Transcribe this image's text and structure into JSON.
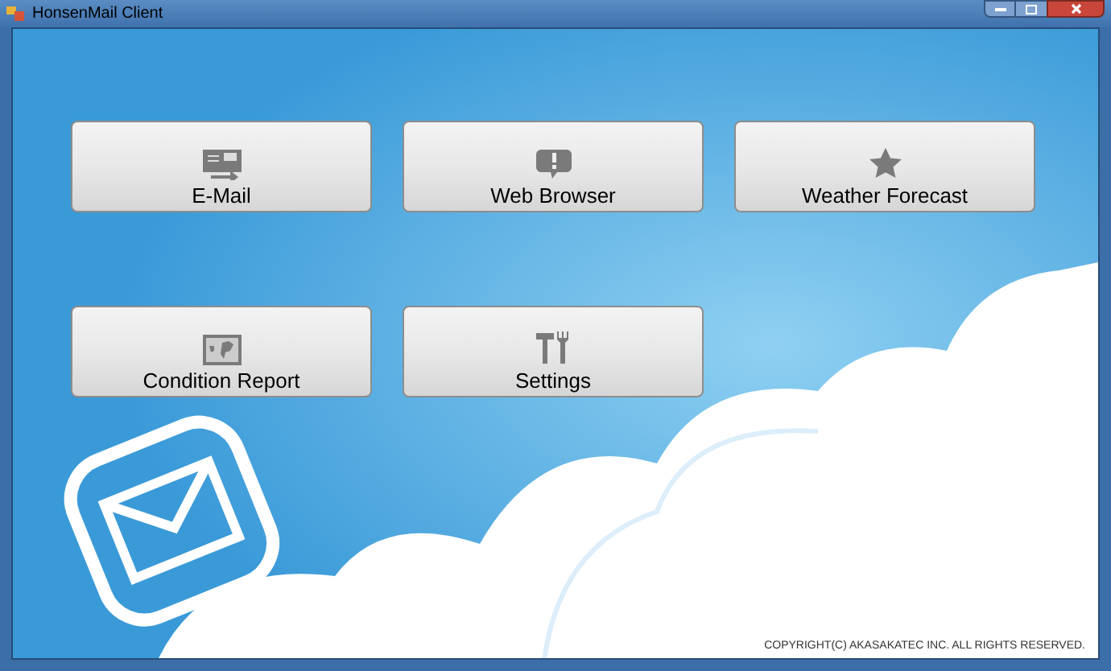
{
  "window": {
    "title": "HonsenMail Client"
  },
  "buttons": [
    {
      "label": "E-Mail",
      "kind": "mail"
    },
    {
      "label": "Web Browser",
      "kind": "chat"
    },
    {
      "label": "Weather Forecast",
      "kind": "star"
    },
    {
      "label": "Condition Report",
      "kind": "map"
    },
    {
      "label": "Settings",
      "kind": "tools"
    }
  ],
  "footer": {
    "copyright": "COPYRIGHT(C) AKASAKATEC INC. ALL RIGHTS RESERVED."
  }
}
